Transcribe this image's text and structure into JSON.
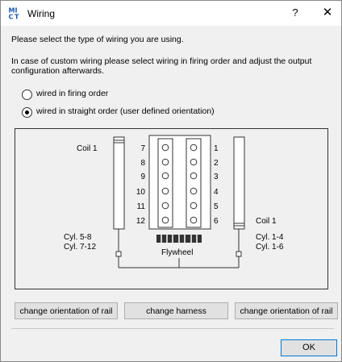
{
  "window": {
    "title": "Wiring",
    "help_label": "?",
    "close_label": "✕",
    "logo_text": "MT"
  },
  "intro": {
    "line1": "Please select the type of wiring you are using.",
    "line2": "In case of custom wiring please select wiring in firing order and adjust the output",
    "line3": "configuration afterwards."
  },
  "options": [
    {
      "label": "wired in firing order",
      "checked": false
    },
    {
      "label": "wired in straight order (user defined orientation)",
      "checked": true
    }
  ],
  "diagram": {
    "coil_left": "Coil 1",
    "coil_right": "Coil 1",
    "left_numbers": [
      "7",
      "8",
      "9",
      "10",
      "11",
      "12"
    ],
    "right_numbers": [
      "1",
      "2",
      "3",
      "4",
      "5",
      "6"
    ],
    "left_cyl_1": "Cyl. 5-8",
    "left_cyl_2": "Cyl. 7-12",
    "right_cyl_1": "Cyl. 1-4",
    "right_cyl_2": "Cyl. 1-6",
    "flywheel": "Flywheel"
  },
  "buttons": {
    "orient_left": "change orientation of rail",
    "harness": "change harness",
    "orient_right": "change orientation of rail",
    "ok": "OK"
  },
  "colors": {
    "accent": "#0078d7",
    "logo_blue": "#1a56b0"
  }
}
